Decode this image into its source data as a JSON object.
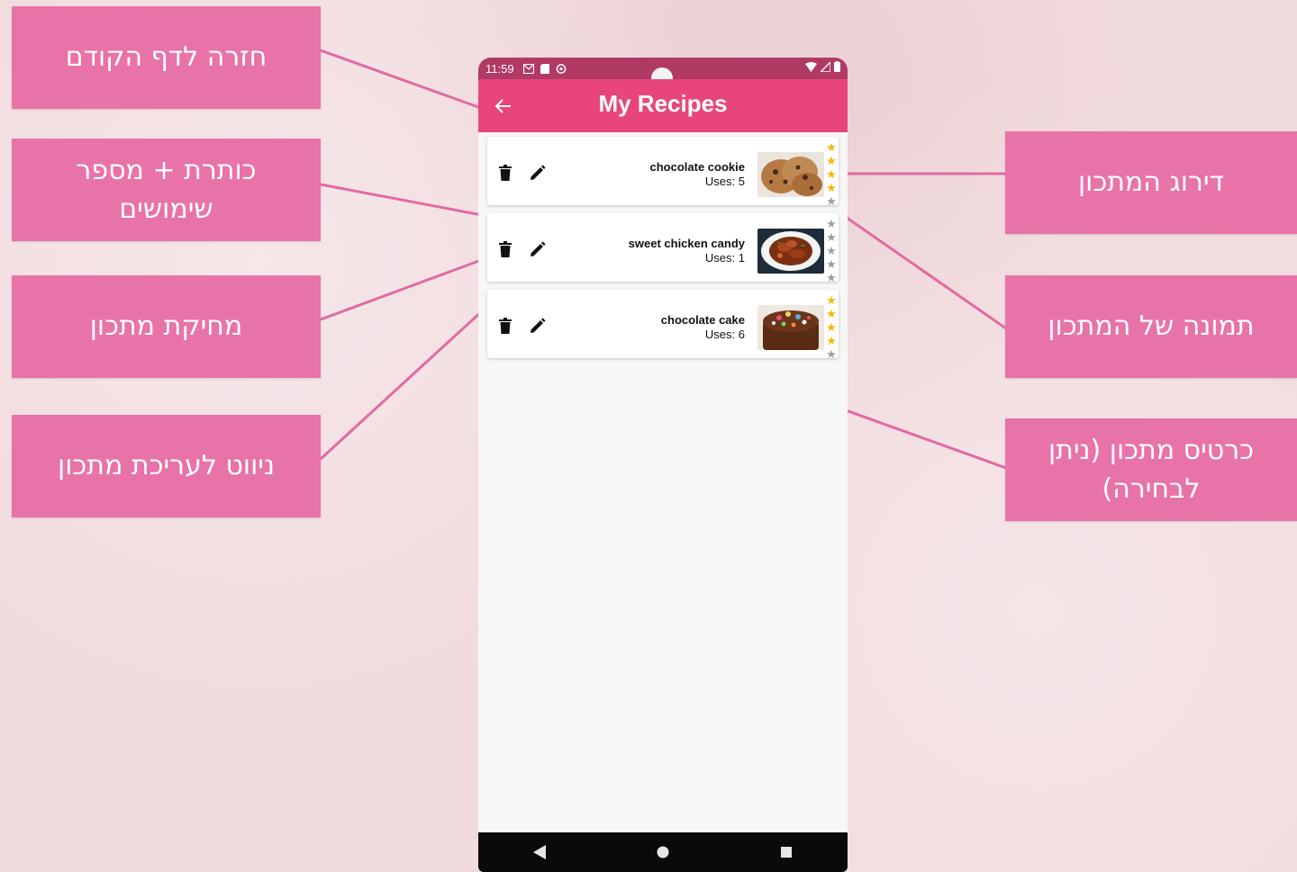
{
  "annotations": {
    "back": "חזרה לדף הקודם",
    "title_uses": "כותרת + מספר שימושים",
    "delete": "מחיקת מתכון",
    "edit": "ניווט לעריכת מתכון",
    "rating": "דירוג המתכון",
    "image": "תמונה של המתכון",
    "card": "כרטיס מתכון (ניתן לבחירה)"
  },
  "status_bar": {
    "time": "11:59"
  },
  "app_bar": {
    "title": "My Recipes",
    "back_icon": "arrow-left-icon"
  },
  "recipes": [
    {
      "title": "chocolate cookie",
      "uses": "Uses:  5",
      "rating": 4,
      "image": "cookie"
    },
    {
      "title": "sweet chicken candy",
      "uses": "Uses:  1",
      "rating": 0,
      "image": "chicken"
    },
    {
      "title": "chocolate cake",
      "uses": "Uses:  6",
      "rating": 4,
      "image": "cake"
    }
  ],
  "colors": {
    "accent": "#e8467a",
    "status_bar": "#b03a64",
    "callout": "#e873a8",
    "star_filled": "#f5b800",
    "star_empty": "#9e9e9e"
  }
}
